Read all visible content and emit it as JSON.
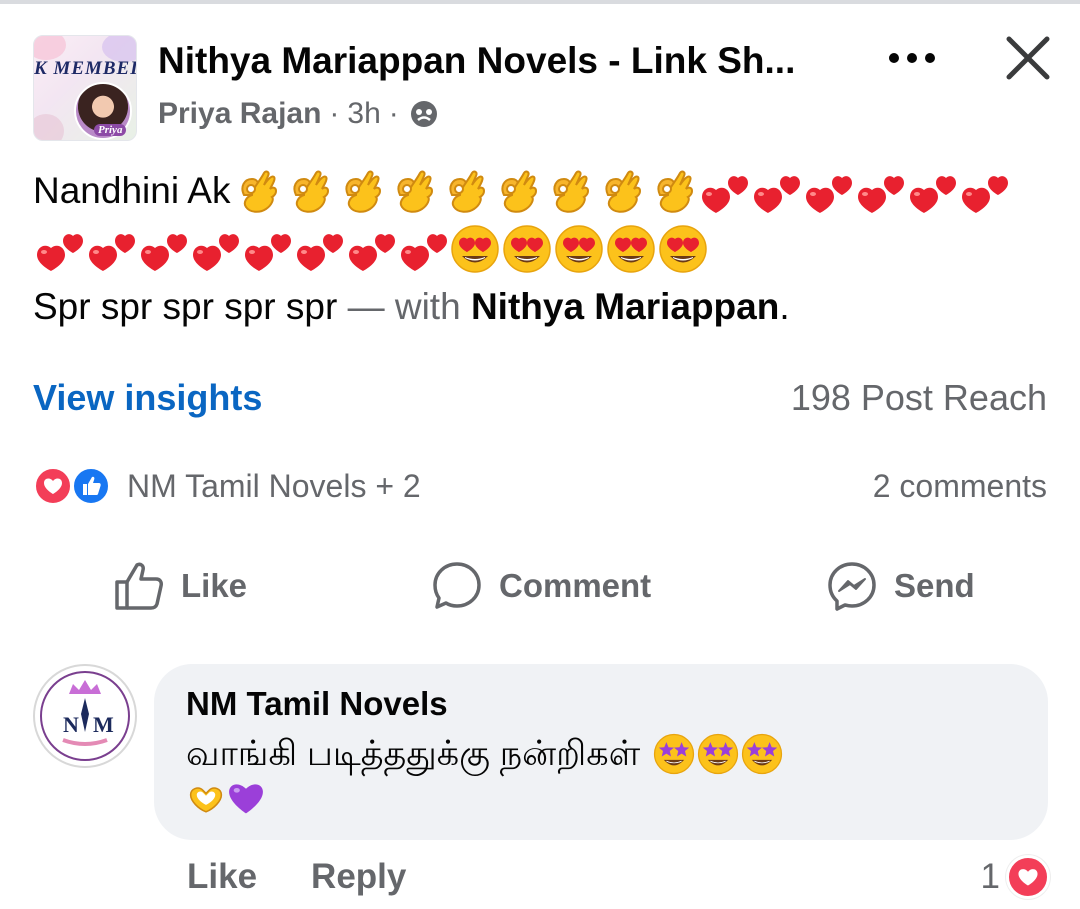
{
  "header": {
    "group_name": "Nithya Mariappan Novels - Link Sh...",
    "group_banner_text": "K MEMBEI",
    "group_avatar_caption": "Priya",
    "author": "Priya Rajan",
    "separator": "·",
    "time": "3h",
    "audience_icon": "globe-icon",
    "more_icon": "more-horizontal-icon",
    "close_icon": "close-icon"
  },
  "post": {
    "line1_text": "Nandhini Ak",
    "line1_emojis": {
      "ok_hand": 9,
      "two_hearts": 6
    },
    "line2_emojis": {
      "two_hearts": 8,
      "heart_eyes": 5
    },
    "line3_text": "Spr spr spr spr spr",
    "with_separator": " — with ",
    "tagged": "Nithya Mariappan",
    "trailing": "."
  },
  "insights": {
    "view_label": "View insights",
    "reach": "198 Post Reach"
  },
  "reactions": {
    "icons": [
      "heart-reaction-icon",
      "like-reaction-icon"
    ],
    "summary": "NM Tamil Novels + 2",
    "comments": "2 comments"
  },
  "actions": {
    "like": "Like",
    "comment": "Comment",
    "send": "Send"
  },
  "comment": {
    "author": "NM Tamil Novels",
    "avatar_text": "NM",
    "text": "வாங்கி படித்ததுக்கு நன்றிகள்",
    "emojis": [
      "star-struck",
      "star-struck",
      "star-struck",
      "heart-hands",
      "purple-heart"
    ],
    "like_label": "Like",
    "reply_label": "Reply",
    "reaction_count": "1"
  },
  "colors": {
    "text_primary": "#050505",
    "text_secondary": "#65676b",
    "link_blue": "#0a66c2",
    "like_blue": "#1877f2",
    "love_red": "#f33e58",
    "bubble_bg": "#f0f2f5"
  }
}
